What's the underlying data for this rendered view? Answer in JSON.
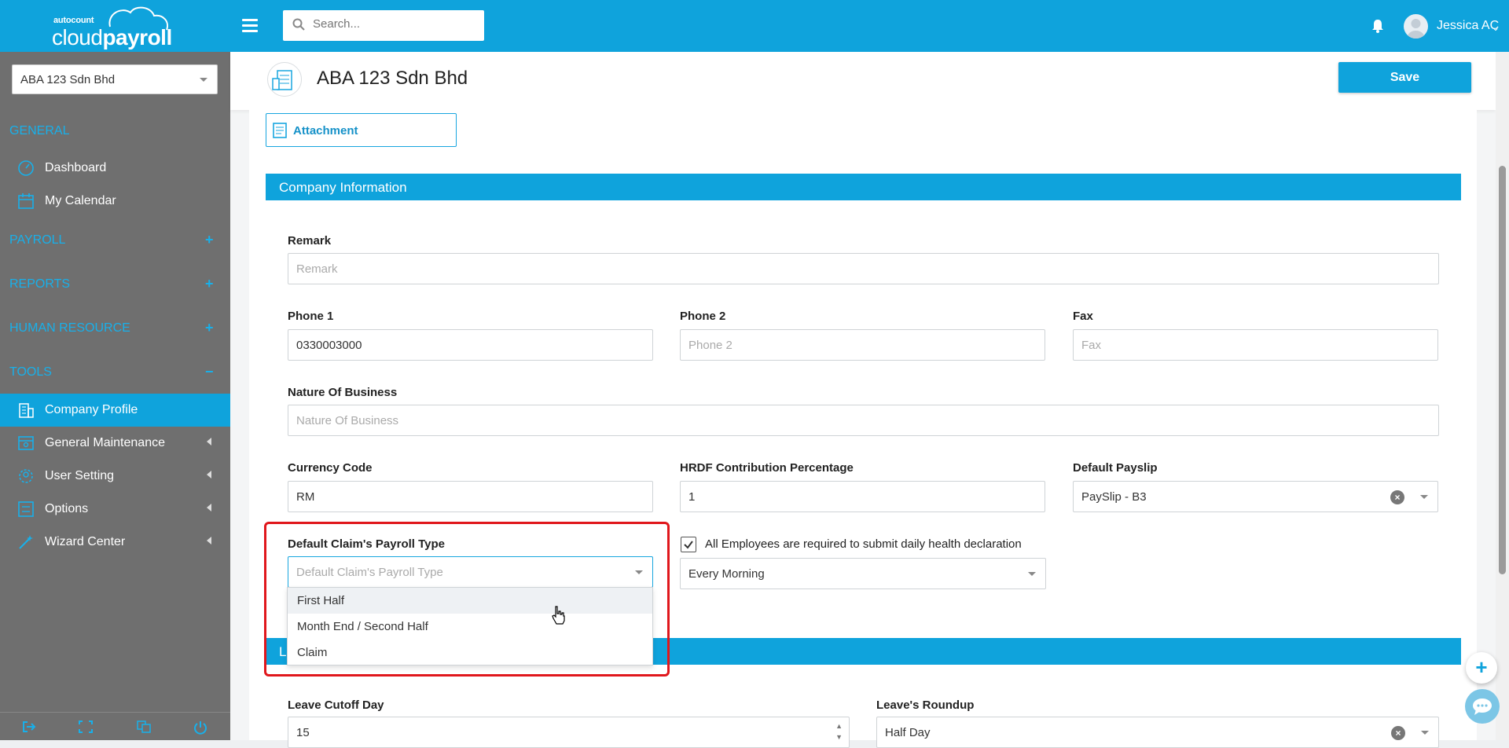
{
  "app": {
    "logo_small": "autocount",
    "logo_cloud": "cloud",
    "logo_payroll": "payroll",
    "search_placeholder": "Search...",
    "user_name": "Jessica AC"
  },
  "sidebar": {
    "company": "ABA 123 Sdn Bhd",
    "sections": [
      {
        "label": "GENERAL"
      },
      {
        "label": "PAYROLL",
        "toggle": "+"
      },
      {
        "label": "REPORTS",
        "toggle": "+"
      },
      {
        "label": "HUMAN RESOURCE",
        "toggle": "+"
      },
      {
        "label": "TOOLS",
        "toggle": "−"
      }
    ],
    "items": [
      {
        "label": "Dashboard"
      },
      {
        "label": "My Calendar"
      },
      {
        "label": "Company Profile"
      },
      {
        "label": "General Maintenance"
      },
      {
        "label": "User Setting"
      },
      {
        "label": "Options"
      },
      {
        "label": "Wizard Center"
      }
    ]
  },
  "header": {
    "title": "ABA 123 Sdn Bhd",
    "save_label": "Save"
  },
  "form": {
    "attachment_label": "Attachment",
    "section_company_info": "Company Information",
    "section_leave_partial": "L",
    "remark": {
      "label": "Remark",
      "placeholder": "Remark",
      "value": ""
    },
    "phone1": {
      "label": "Phone 1",
      "value": "0330003000"
    },
    "phone2": {
      "label": "Phone 2",
      "placeholder": "Phone 2"
    },
    "fax": {
      "label": "Fax",
      "placeholder": "Fax"
    },
    "nature": {
      "label": "Nature Of Business",
      "placeholder": "Nature Of Business"
    },
    "currency": {
      "label": "Currency Code",
      "value": "RM"
    },
    "hrdf": {
      "label": "HRDF Contribution Percentage",
      "value": "1"
    },
    "payslip": {
      "label": "Default Payslip",
      "value": "PaySlip - B3"
    },
    "claim_type": {
      "label": "Default Claim's Payroll Type",
      "placeholder": "Default Claim's Payroll Type",
      "options": [
        "First Half",
        "Month End / Second Half",
        "Claim"
      ]
    },
    "health": {
      "label": "All Employees are required to submit daily health declaration",
      "checked": true,
      "frequency": "Every Morning"
    },
    "leave_cutoff": {
      "label": "Leave Cutoff Day",
      "value": "15"
    },
    "leave_roundup": {
      "label": "Leave's Roundup",
      "value": "Half Day"
    }
  },
  "colors": {
    "brand": "#0fa3dc",
    "sidebar_bg": "#6f6f6f",
    "highlight_box": "#e0171c"
  }
}
